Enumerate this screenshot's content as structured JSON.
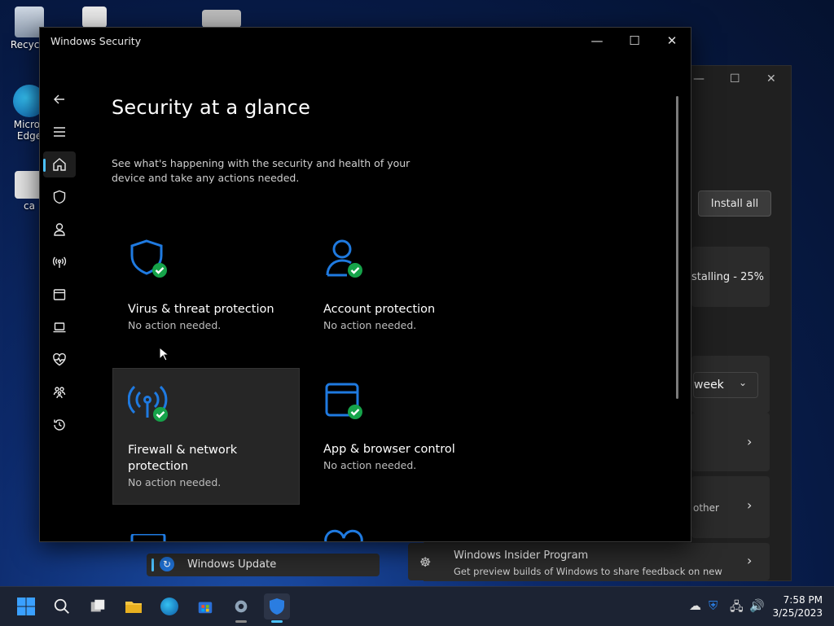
{
  "desktop": {
    "icons": [
      {
        "label": "Recycle"
      },
      {
        "label": "Micros Edge"
      },
      {
        "label": "ca"
      }
    ]
  },
  "background_window": {
    "install_all": "Install all",
    "installing": "stalling - 25%",
    "pause_value": "week",
    "other_text": "other",
    "update_tab": "Windows Update",
    "insider_title": "Windows Insider Program",
    "insider_desc": "Get preview builds of Windows to share feedback on new"
  },
  "window": {
    "title": "Windows Security",
    "minimize": "—",
    "maximize": "☐",
    "close": "✕"
  },
  "page": {
    "heading": "Security at a glance",
    "subtitle": "See what's happening with the security and health of your device and take any actions needed."
  },
  "tiles": [
    {
      "name": "Virus & threat protection",
      "status": "No action needed."
    },
    {
      "name": "Account protection",
      "status": "No action needed."
    },
    {
      "name": "Firewall & network protection",
      "status": "No action needed."
    },
    {
      "name": "App & browser control",
      "status": "No action needed."
    }
  ],
  "colors": {
    "accent": "#4cc2ff",
    "icon_blue": "#1f7ae0",
    "ok_green": "#16a34a"
  },
  "taskbar": {
    "time": "7:58 PM",
    "date": "3/25/2023"
  }
}
